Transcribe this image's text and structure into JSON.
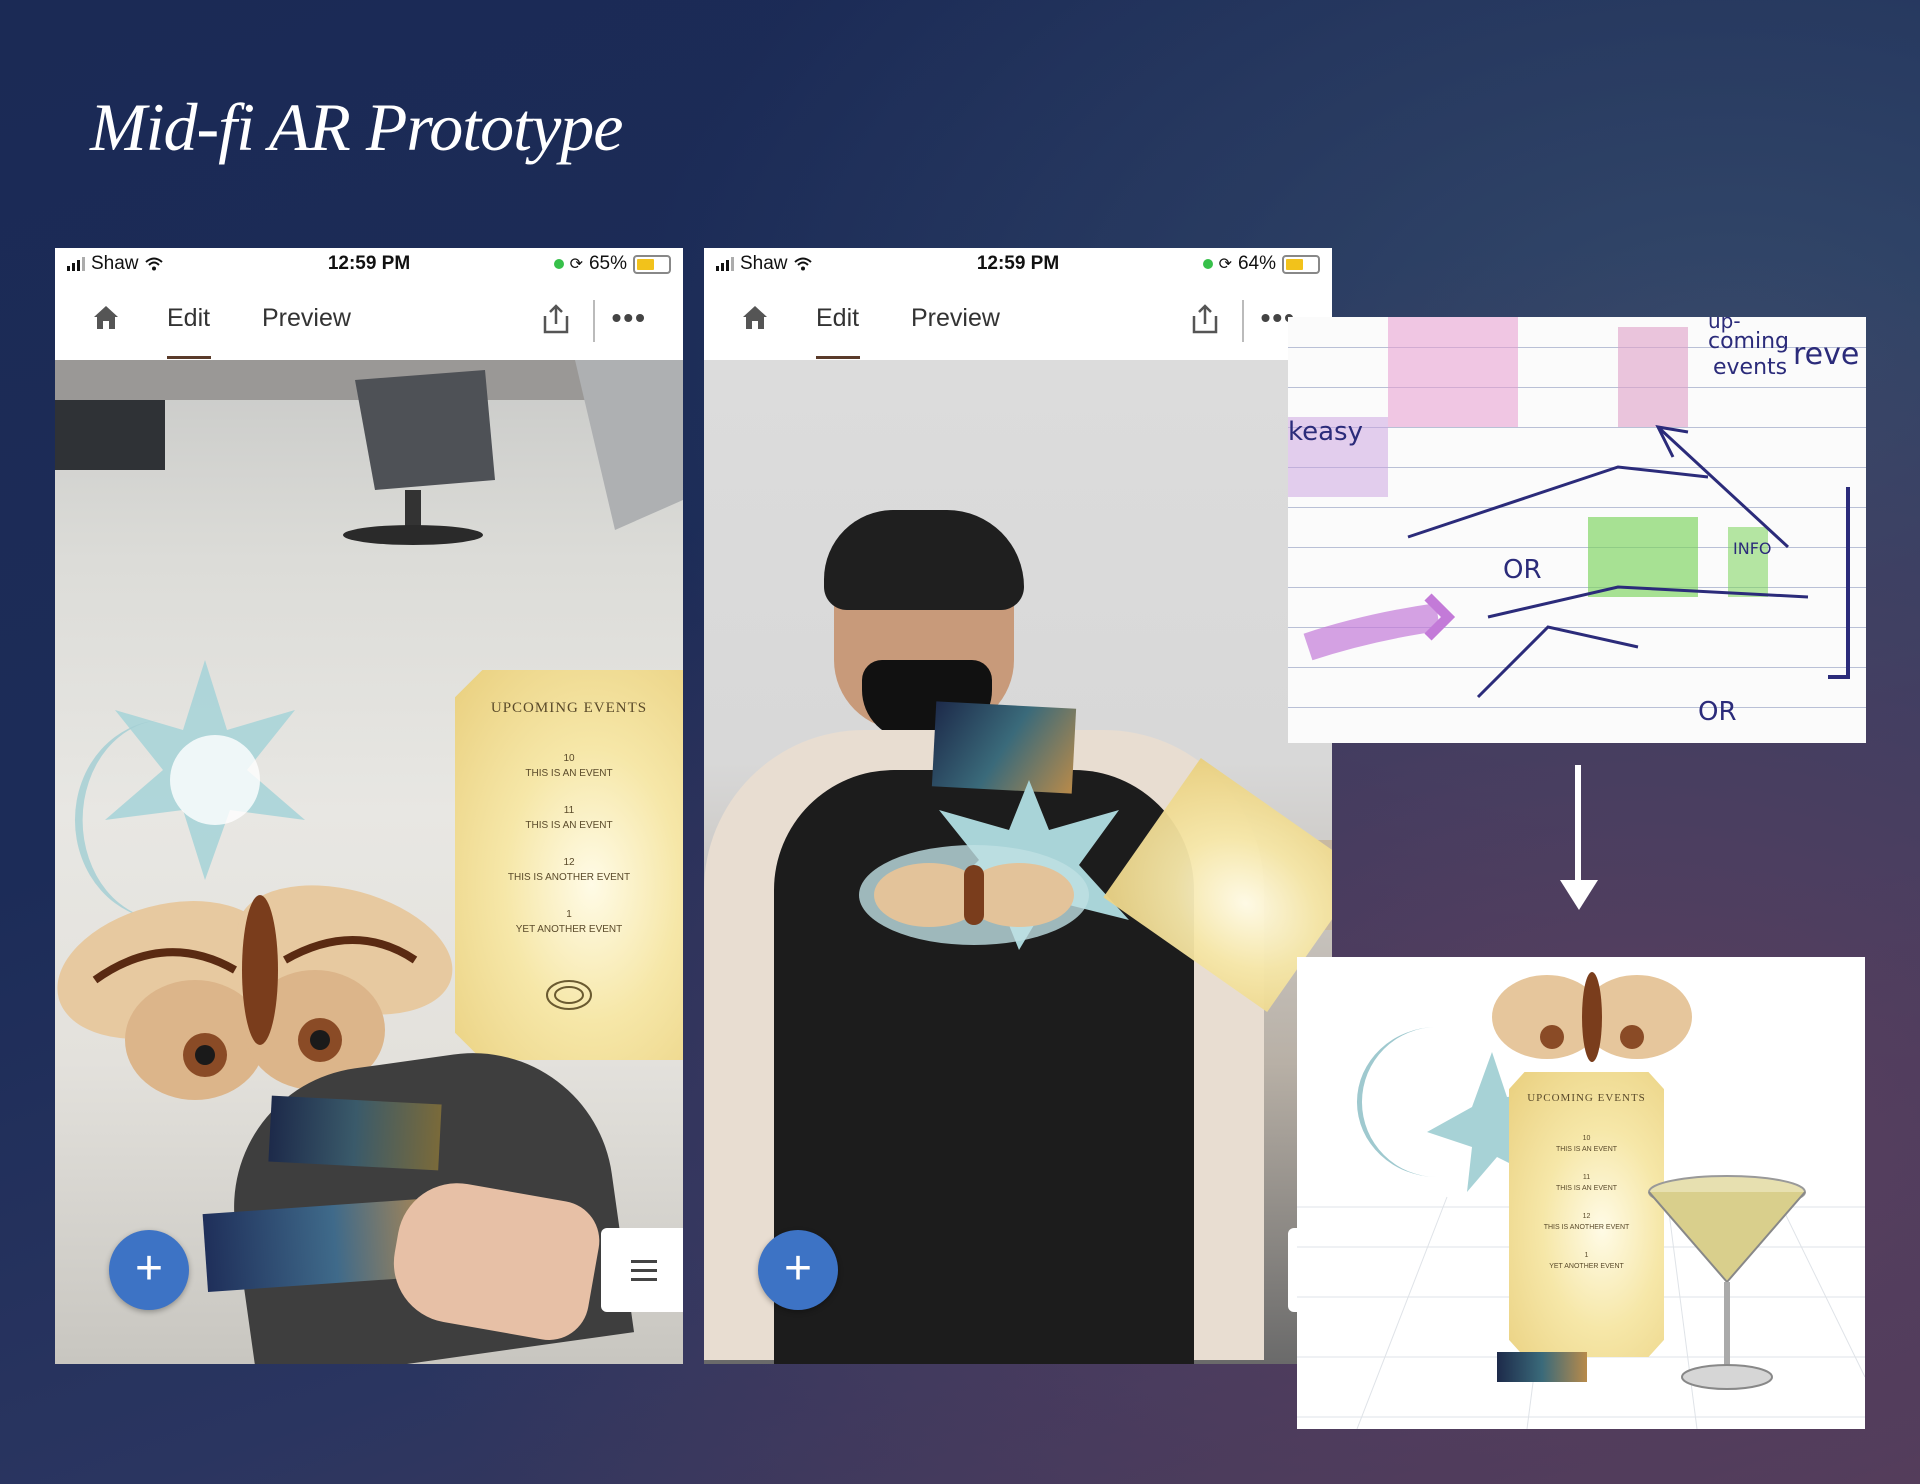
{
  "title": "Mid-fi AR Prototype",
  "phones": [
    {
      "carrier": "Shaw",
      "time": "12:59 PM",
      "battery_label": "65%",
      "battery_level": 0.65,
      "tabs": [
        "Edit",
        "Preview"
      ],
      "active_tab": "Edit",
      "fab_label": "+"
    },
    {
      "carrier": "Shaw",
      "time": "12:59 PM",
      "battery_label": "64%",
      "battery_level": 0.64,
      "tabs": [
        "Edit",
        "Preview"
      ],
      "active_tab": "Edit",
      "fab_label": "+"
    }
  ],
  "ticket": {
    "heading": "UPCOMING EVENTS",
    "events": [
      {
        "day": "10",
        "name": "THIS IS AN EVENT"
      },
      {
        "day": "11",
        "name": "THIS IS AN EVENT"
      },
      {
        "day": "12",
        "name": "THIS IS ANOTHER EVENT"
      },
      {
        "day": "1",
        "name": "YET ANOTHER EVENT"
      }
    ]
  },
  "sketch": {
    "notes": [
      "up-",
      "coming",
      "events",
      "reve",
      "keasy",
      "OR",
      "OR",
      "INFO",
      "OR"
    ]
  },
  "colors": {
    "accent_blue": "#3d73c5",
    "ticket_gold": "#f3e3a0",
    "battery_yellow": "#f2c21b"
  }
}
